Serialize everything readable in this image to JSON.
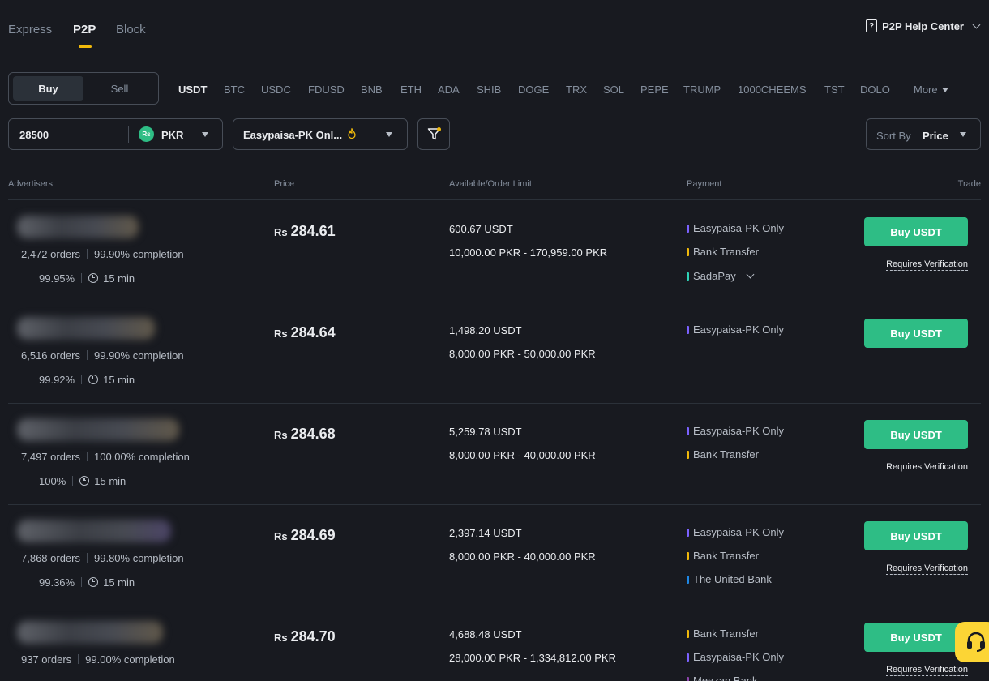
{
  "nav": {
    "tabs": [
      {
        "label": "Express",
        "active": false
      },
      {
        "label": "P2P",
        "active": true
      },
      {
        "label": "Block",
        "active": false
      }
    ],
    "help_center": "P2P Help Center"
  },
  "toggle": {
    "buy": "Buy",
    "sell": "Sell",
    "selected": "Buy"
  },
  "coins": [
    "USDT",
    "BTC",
    "USDC",
    "FDUSD",
    "BNB",
    "ETH",
    "ADA",
    "SHIB",
    "DOGE",
    "TRX",
    "SOL",
    "PEPE",
    "TRUMP",
    "1000CHEEMS",
    "TST",
    "DOLO"
  ],
  "coins_active": "USDT",
  "more_label": "More",
  "filters": {
    "amount": "28500",
    "currency_badge": "Rs",
    "currency": "PKR",
    "payment": "Easypaisa-PK Onl...",
    "sort_label": "Sort By",
    "sort_value": "Price"
  },
  "table_headers": {
    "advertisers": "Advertisers",
    "price": "Price",
    "available": "Available/Order Limit",
    "payment": "Payment",
    "trade": "Trade"
  },
  "colors": {
    "accent": "#f0b90b",
    "buy_green": "#2ebd85",
    "pm_easypaisa": "#7b61ff",
    "pm_bank": "#f0b90b",
    "pm_sadapay": "#2ed3b7",
    "pm_ubl": "#1e88e5",
    "pm_meezan": "#8e44ad"
  },
  "currency_symbol": "Rs",
  "rows": [
    {
      "orders": "2,472 orders",
      "completion": "99.90% completion",
      "rate": "99.95%",
      "time": "15 min",
      "price": "284.61",
      "available": "600.67 USDT",
      "limit": "10,000.00 PKR - 170,959.00 PKR",
      "payments": [
        "Easypaisa-PK Only",
        "Bank Transfer",
        "SadaPay"
      ],
      "button": "Buy USDT",
      "requires": "Requires Verification"
    },
    {
      "orders": "6,516 orders",
      "completion": "99.90% completion",
      "rate": "99.92%",
      "time": "15 min",
      "price": "284.64",
      "available": "1,498.20 USDT",
      "limit": "8,000.00 PKR - 50,000.00 PKR",
      "payments": [
        "Easypaisa-PK Only"
      ],
      "button": "Buy USDT",
      "requires": ""
    },
    {
      "orders": "7,497 orders",
      "completion": "100.00% completion",
      "rate": "100%",
      "time": "15 min",
      "price": "284.68",
      "available": "5,259.78 USDT",
      "limit": "8,000.00 PKR - 40,000.00 PKR",
      "payments": [
        "Easypaisa-PK Only",
        "Bank Transfer"
      ],
      "button": "Buy USDT",
      "requires": "Requires Verification"
    },
    {
      "orders": "7,868 orders",
      "completion": "99.80% completion",
      "rate": "99.36%",
      "time": "15 min",
      "price": "284.69",
      "available": "2,397.14 USDT",
      "limit": "8,000.00 PKR - 40,000.00 PKR",
      "payments": [
        "Easypaisa-PK Only",
        "Bank Transfer",
        "The United Bank"
      ],
      "button": "Buy USDT",
      "requires": "Requires Verification"
    },
    {
      "orders": "937 orders",
      "completion": "99.00% completion",
      "rate": "",
      "time": "",
      "price": "284.70",
      "available": "4,688.48 USDT",
      "limit": "28,000.00 PKR - 1,334,812.00 PKR",
      "payments": [
        "Bank Transfer",
        "Easypaisa-PK Only",
        "Meezan Bank"
      ],
      "button": "Buy USDT",
      "requires": "Requires Verification"
    }
  ]
}
